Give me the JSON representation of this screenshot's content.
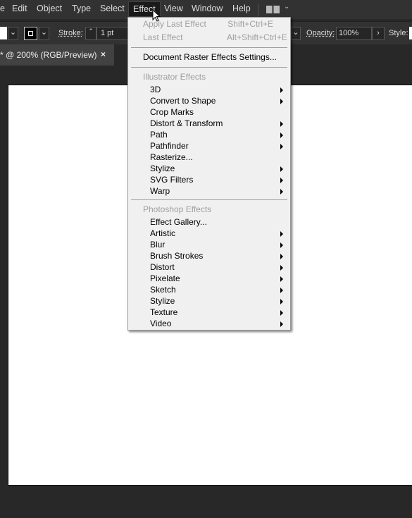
{
  "menubar": {
    "items": [
      "e",
      "Edit",
      "Object",
      "Type",
      "Select",
      "Effect",
      "View",
      "Window",
      "Help"
    ],
    "active": "Effect"
  },
  "control": {
    "stroke_label": "Stroke:",
    "stroke_value": "1 pt",
    "opacity_label": "Opacity:",
    "opacity_value": "100%",
    "style_label": "Style:"
  },
  "document_tab": {
    "title": "* @ 200% (RGB/Preview)",
    "close": "×"
  },
  "effect_menu": {
    "apply_last": {
      "label": "Apply Last Effect",
      "shortcut": "Shift+Ctrl+E"
    },
    "last": {
      "label": "Last Effect",
      "shortcut": "Alt+Shift+Ctrl+E"
    },
    "raster_settings": "Document Raster Effects Settings...",
    "illustrator_header": "Illustrator Effects",
    "illustrator_items": [
      {
        "label": "3D",
        "sub": true
      },
      {
        "label": "Convert to Shape",
        "sub": true
      },
      {
        "label": "Crop Marks",
        "sub": false
      },
      {
        "label": "Distort & Transform",
        "sub": true
      },
      {
        "label": "Path",
        "sub": true
      },
      {
        "label": "Pathfinder",
        "sub": true
      },
      {
        "label": "Rasterize...",
        "sub": false
      },
      {
        "label": "Stylize",
        "sub": true
      },
      {
        "label": "SVG Filters",
        "sub": true
      },
      {
        "label": "Warp",
        "sub": true
      }
    ],
    "photoshop_header": "Photoshop Effects",
    "photoshop_items": [
      {
        "label": "Effect Gallery...",
        "sub": false
      },
      {
        "label": "Artistic",
        "sub": true
      },
      {
        "label": "Blur",
        "sub": true
      },
      {
        "label": "Brush Strokes",
        "sub": true
      },
      {
        "label": "Distort",
        "sub": true
      },
      {
        "label": "Pixelate",
        "sub": true
      },
      {
        "label": "Sketch",
        "sub": true
      },
      {
        "label": "Stylize",
        "sub": true
      },
      {
        "label": "Texture",
        "sub": true
      },
      {
        "label": "Video",
        "sub": true
      }
    ]
  }
}
